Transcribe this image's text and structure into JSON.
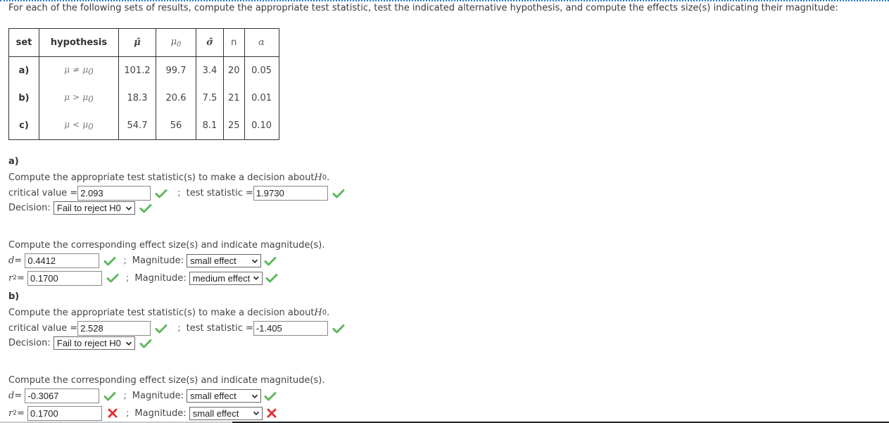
{
  "intro": "For each of the following sets of results, compute the appropriate test statistic, test the indicated alternative hypothesis, and compute the effects size(s) indicating their magnitude:",
  "table": {
    "headers": [
      "set",
      "hypothesis",
      "μ̂",
      "μ",
      "σ̂",
      "n",
      "α"
    ],
    "mu0_sub": "0",
    "rows": [
      {
        "set": "a)",
        "hyp_lhs": "μ",
        "hyp_op": "≠",
        "hyp_rhs": "μ",
        "hyp_sub": "0",
        "mu_hat": "101.2",
        "mu0": "99.7",
        "sigma_hat": "3.4",
        "n": "20",
        "alpha": "0.05"
      },
      {
        "set": "b)",
        "hyp_lhs": "μ",
        "hyp_op": ">",
        "hyp_rhs": "μ",
        "hyp_sub": "0",
        "mu_hat": "18.3",
        "mu0": "20.6",
        "sigma_hat": "7.5",
        "n": "21",
        "alpha": "0.01"
      },
      {
        "set": "c)",
        "hyp_lhs": "μ",
        "hyp_op": "<",
        "hyp_rhs": "μ",
        "hyp_sub": "0",
        "mu_hat": "54.7",
        "mu0": "56",
        "sigma_hat": "8.1",
        "n": "25",
        "alpha": "0.10"
      }
    ]
  },
  "labels": {
    "compute_stat": "Compute the appropriate test statistic(s) to make a decision about ",
    "h0": "H",
    "h0_sub": "0",
    "period": ".",
    "critical_value": "critical value = ",
    "test_statistic": "test statistic = ",
    "semicolon": ";",
    "decision": "Decision: ",
    "compute_effect": "Compute the corresponding effect size(s) and indicate magnitude(s).",
    "d_eq": "d",
    "r2_r": "r",
    "r2_sup": "2",
    "eq": " = ",
    "magnitude": "Magnitude: "
  },
  "colors": {
    "correct": "#5cb85c",
    "incorrect": "#e03131"
  },
  "sections": [
    {
      "label": "a)",
      "critical_value": "2.093",
      "critical_status": "correct",
      "test_statistic": "1.9730",
      "test_status": "correct",
      "decision": "Fail to reject H0",
      "decision_status": "correct",
      "d": "0.4412",
      "d_status": "correct",
      "d_magnitude": "small effect",
      "d_magnitude_status": "correct",
      "r2": "0.1700",
      "r2_status": "correct",
      "r2_magnitude": "medium effect",
      "r2_magnitude_status": "correct"
    },
    {
      "label": "b)",
      "critical_value": "2.528",
      "critical_status": "correct",
      "test_statistic": "-1.405",
      "test_status": "correct",
      "decision": "Fail to reject H0",
      "decision_status": "correct",
      "d": "-0.3067",
      "d_status": "correct",
      "d_magnitude": "small effect",
      "d_magnitude_status": "correct",
      "r2": "0.1700",
      "r2_status": "incorrect",
      "r2_magnitude": "small effect",
      "r2_magnitude_status": "incorrect"
    }
  ]
}
